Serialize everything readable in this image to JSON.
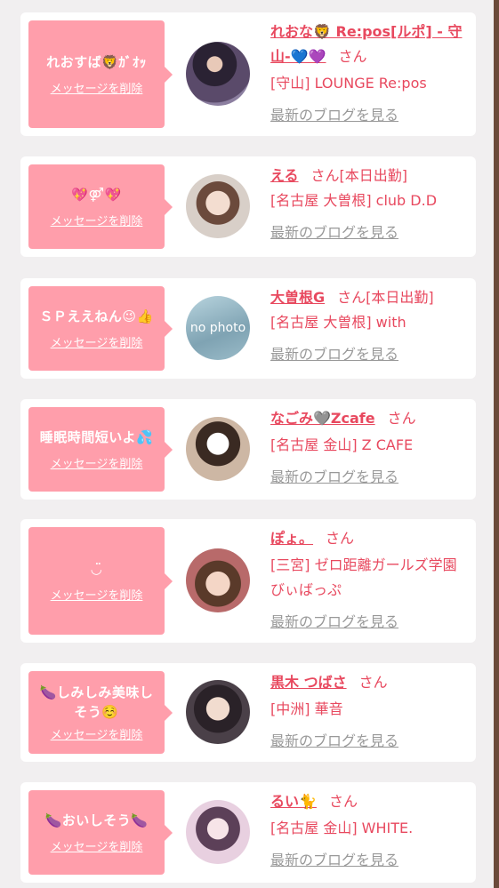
{
  "delete_label": "メッセージを削除",
  "blog_label": "最新のブログを見る",
  "san_label": "さん",
  "colors": {
    "bubble": "#ff9eab",
    "accent": "#e8495f",
    "muted": "#999999"
  },
  "items": [
    {
      "message": "れおすば🦁ｶﾞｵｯ",
      "name": "れおな🦁 Re:pos[ルポ] - 守山-💙💜",
      "status": "",
      "shop": "[守山] LOUNGE Re:pos",
      "avatar": "avatar-photo"
    },
    {
      "message": "💖⚤💖",
      "name": "える",
      "status": "[本日出勤]",
      "shop": "[名古屋 大曽根] club D.D",
      "avatar": "avatar-photo"
    },
    {
      "message": "ＳＰええねん😉👍",
      "name": "大曽根G",
      "status": "[本日出勤]",
      "shop": "[名古屋 大曽根] with",
      "avatar": "no photo"
    },
    {
      "message": "睡眠時間短いよ💦",
      "name": "なごみ🩶Zcafe",
      "status": "",
      "shop": "[名古屋 金山] Z CAFE",
      "avatar": "avatar-photo"
    },
    {
      "message": "◡̈",
      "name": "ぽょ。",
      "status": "",
      "shop": "[三宮] ゼロ距離ガールズ学園　びぃばっぷ",
      "avatar": "avatar-photo"
    },
    {
      "message": "🍆しみしみ美味しそう☺️",
      "name": "黒木 つばさ",
      "status": "",
      "shop": "[中洲] 華音",
      "avatar": "avatar-photo"
    },
    {
      "message": "🍆おいしそう🍆",
      "name": "るい🐈",
      "status": "",
      "shop": "[名古屋 金山] WHITE.",
      "avatar": "avatar-photo"
    }
  ]
}
